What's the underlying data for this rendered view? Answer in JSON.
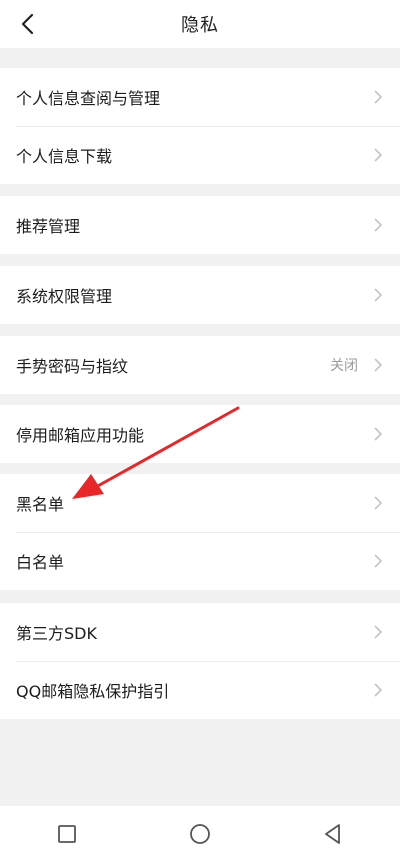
{
  "header": {
    "title": "隐私",
    "back_icon": "chevron-left-icon"
  },
  "groups": [
    [
      {
        "label": "个人信息查阅与管理"
      },
      {
        "label": "个人信息下载"
      }
    ],
    [
      {
        "label": "推荐管理"
      }
    ],
    [
      {
        "label": "系统权限管理"
      }
    ],
    [
      {
        "label": "手势密码与指纹",
        "value": "关闭"
      }
    ],
    [
      {
        "label": "停用邮箱应用功能"
      }
    ],
    [
      {
        "label": "黑名单"
      },
      {
        "label": "白名单"
      }
    ],
    [
      {
        "label": "第三方SDK"
      },
      {
        "label": "QQ邮箱隐私保护指引"
      }
    ]
  ],
  "colors": {
    "annotation_arrow": "#e8272a",
    "background": "#f1f1f1",
    "chevron": "#c4c4c4"
  },
  "navbar": {
    "icons": [
      "square-icon",
      "circle-icon",
      "triangle-back-icon"
    ]
  }
}
